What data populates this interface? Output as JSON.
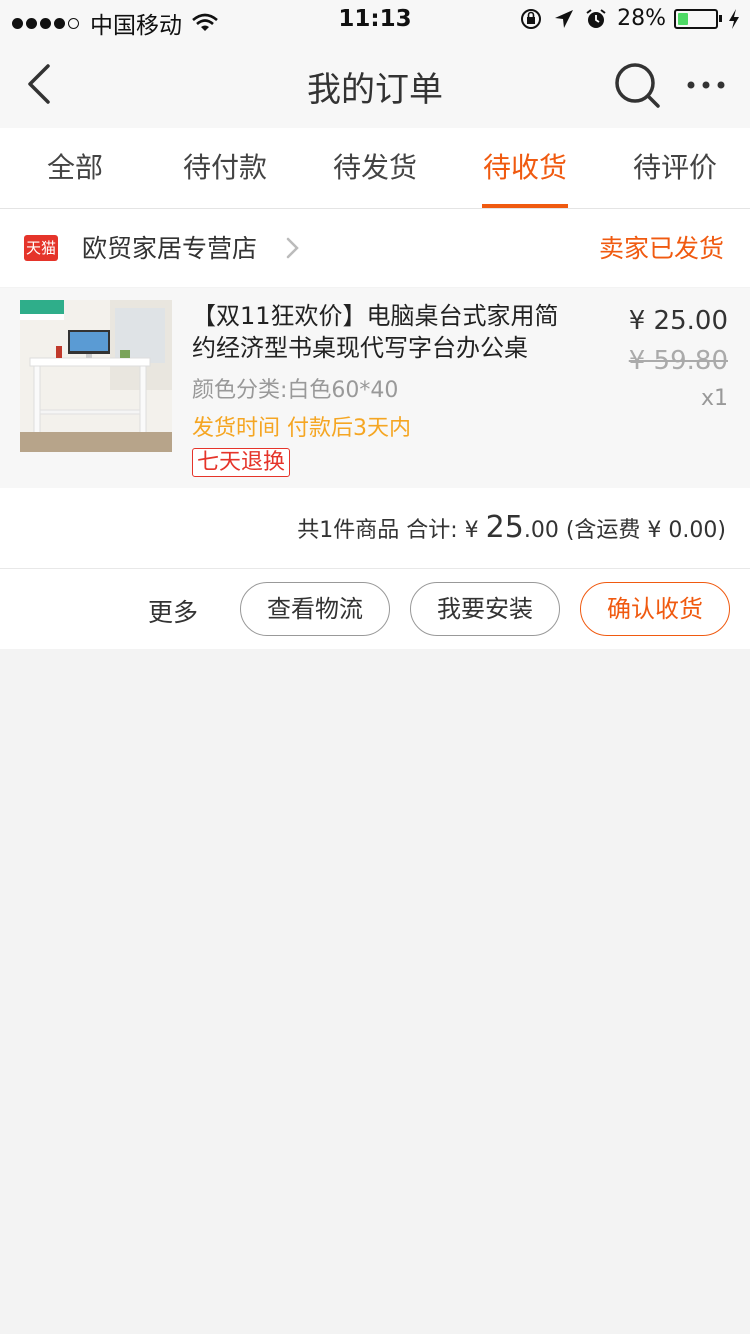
{
  "status_bar": {
    "carrier": "中国移动",
    "time": "11:13",
    "battery": "28%",
    "battery_level": 0.28
  },
  "nav": {
    "title": "我的订单"
  },
  "tabs": [
    {
      "label": "全部"
    },
    {
      "label": "待付款"
    },
    {
      "label": "待发货"
    },
    {
      "label": "待收货",
      "active": true
    },
    {
      "label": "待评价"
    }
  ],
  "store": {
    "logo_text": "天猫",
    "name": "欧贸家居专营店",
    "status": "卖家已发货"
  },
  "product": {
    "title": "【双11狂欢价】电脑桌台式家用简约经济型书桌现代写字台办公桌",
    "sku": "颜色分类:白色60*40",
    "ship_time": "发货时间 付款后3天内",
    "tag": "七天退换",
    "price": "¥ 25.00",
    "original_price": "¥ 59.80",
    "quantity": "x1"
  },
  "summary": {
    "count_label": "共1件商品 合计: ¥ ",
    "total_int": "25",
    "total_dec": ".00",
    "shipping": " (含运费 ¥ 0.00)"
  },
  "actions": {
    "more": "更多",
    "logistics": "查看物流",
    "install": "我要安装",
    "confirm": "确认收货"
  },
  "colors": {
    "accent": "#f05a10",
    "tmall_red": "#e5342a",
    "ship_orange": "#f5a623",
    "background": "#f3f3f3"
  }
}
